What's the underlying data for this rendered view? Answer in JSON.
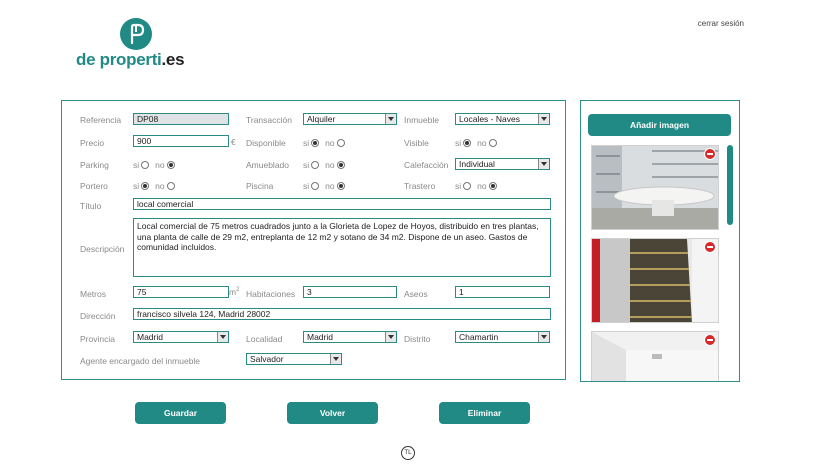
{
  "header": {
    "logo_main": "de properti",
    "logo_ext": ".es",
    "logout": "cerrar sesión"
  },
  "form": {
    "referencia": {
      "label": "Referencia",
      "value": "DP08"
    },
    "transaccion": {
      "label": "Transacción",
      "value": "Alquiler"
    },
    "inmueble": {
      "label": "Inmueble",
      "value": "Locales - Naves"
    },
    "precio": {
      "label": "Precio",
      "value": "900",
      "unit": "€"
    },
    "disponible": {
      "label": "Disponible",
      "yes": "si",
      "no": "no",
      "selected": "si"
    },
    "visible": {
      "label": "Visible",
      "yes": "si",
      "no": "no",
      "selected": "si"
    },
    "parking": {
      "label": "Parking",
      "yes": "si",
      "no": "no",
      "selected": "no"
    },
    "amueblado": {
      "label": "Amueblado",
      "yes": "si",
      "no": "no",
      "selected": "no"
    },
    "calefaccion": {
      "label": "Calefacción",
      "value": "Individual"
    },
    "portero": {
      "label": "Portero",
      "yes": "si",
      "no": "no",
      "selected": "si"
    },
    "piscina": {
      "label": "Piscina",
      "yes": "si",
      "no": "no",
      "selected": "no"
    },
    "trastero": {
      "label": "Trastero",
      "yes": "si",
      "no": "no",
      "selected": "no"
    },
    "titulo": {
      "label": "Título",
      "value": "local comercial"
    },
    "descripcion": {
      "label": "Descripción",
      "value": "Local comercial de 75 metros cuadrados junto a la Glorieta de Lopez de Hoyos, distribuido en tres plantas, una planta de calle de 29 m2, entreplanta de 12 m2 y sotano de 34 m2. Dispone de un aseo. Gastos de comunidad incluidos."
    },
    "metros": {
      "label": "Metros",
      "value": "75",
      "unit": "m",
      "unit_sup": "2"
    },
    "habitaciones": {
      "label": "Habitaciones",
      "value": "3"
    },
    "aseos": {
      "label": "Aseos",
      "value": "1"
    },
    "direccion": {
      "label": "Dirección",
      "value": "francisco silvela 124, Madrid 28002"
    },
    "provincia": {
      "label": "Provincia",
      "value": "Madrid"
    },
    "localidad": {
      "label": "Localidad",
      "value": "Madrid"
    },
    "distrito": {
      "label": "Distrito",
      "value": "Chamartin"
    },
    "agente": {
      "label": "Agente encargado del inmueble",
      "value": "Salvador"
    }
  },
  "gallery": {
    "add_label": "Añadir imagen",
    "images": [
      "office-table-photo",
      "staircase-photo",
      "empty-room-photo"
    ]
  },
  "actions": {
    "save": "Guardar",
    "back": "Volver",
    "delete": "Eliminar"
  },
  "footer": {
    "mark": "TL"
  },
  "colors": {
    "accent": "#218a84",
    "delete": "#d62a2a"
  }
}
